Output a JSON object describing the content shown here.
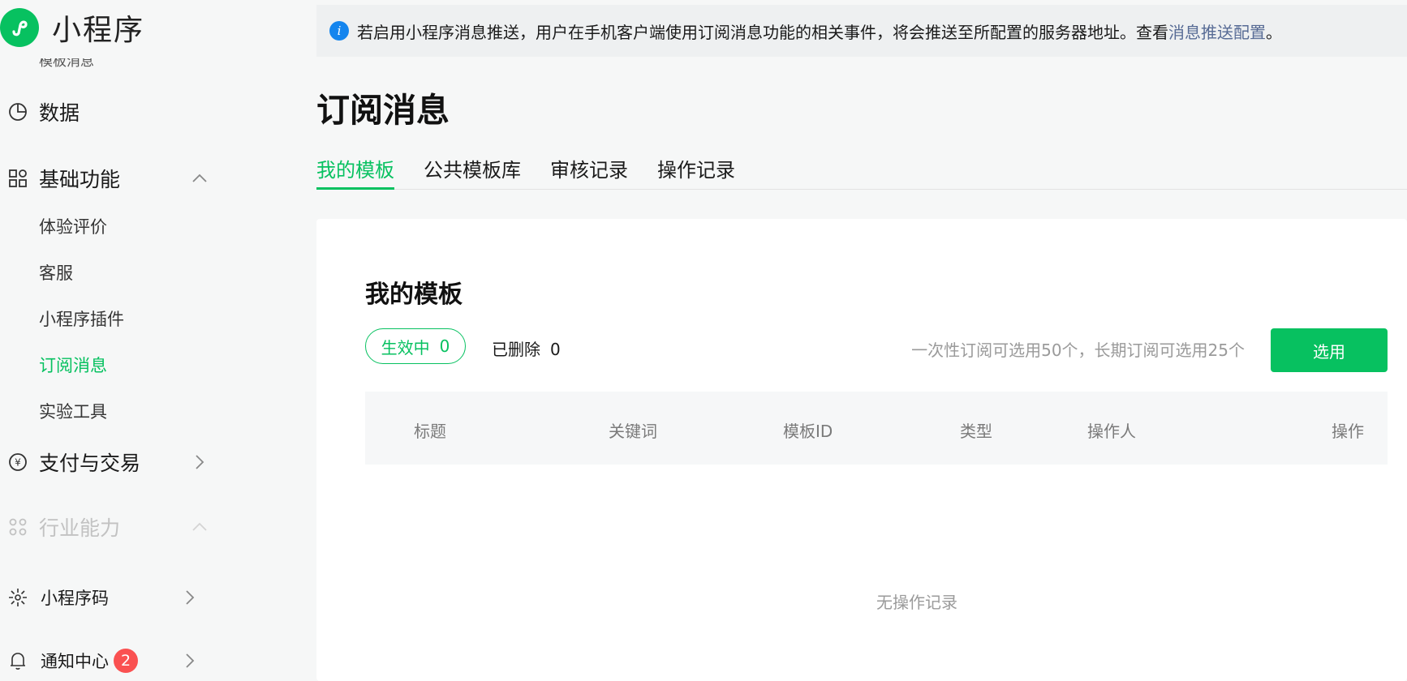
{
  "app": {
    "title": "小程序",
    "brand_color": "#07c160"
  },
  "sidebar": {
    "clipped_item": "模板消息",
    "data": {
      "label": "数据",
      "icon": "pie-chart-icon"
    },
    "basic": {
      "label": "基础功能",
      "icon": "apps-grid-icon",
      "expanded": true,
      "items": [
        {
          "label": "体验评价"
        },
        {
          "label": "客服"
        },
        {
          "label": "小程序插件"
        },
        {
          "label": "订阅消息",
          "active": true
        },
        {
          "label": "实验工具"
        }
      ]
    },
    "payment": {
      "label": "支付与交易",
      "icon": "yuan-circle-icon"
    },
    "industry": {
      "label": "行业能力",
      "icon": "nodes-icon",
      "disabled": true
    },
    "qrcode": {
      "label": "小程序码",
      "icon": "sparkle-icon"
    },
    "notify": {
      "label": "通知中心",
      "icon": "bell-icon",
      "badge": "2"
    }
  },
  "notice": {
    "text": "若启用小程序消息推送，用户在手机客户端使用订阅消息功能的相关事件，将会推送至所配置的服务器地址。查看",
    "link": "消息推送配置",
    "suffix": "。"
  },
  "page": {
    "title": "订阅消息"
  },
  "tabs": [
    {
      "label": "我的模板",
      "active": true
    },
    {
      "label": "公共模板库"
    },
    {
      "label": "审核记录"
    },
    {
      "label": "操作记录"
    }
  ],
  "card": {
    "title": "我的模板",
    "filters": {
      "active": {
        "label": "生效中",
        "count": "0"
      },
      "deleted": {
        "label": "已删除",
        "count": "0"
      }
    },
    "limit_text": "一次性订阅可选用50个，长期订阅可选用25个",
    "select_button": "选用",
    "columns": [
      "标题",
      "关键词",
      "模板ID",
      "类型",
      "操作人",
      "操作"
    ],
    "empty_text": "无操作记录"
  }
}
